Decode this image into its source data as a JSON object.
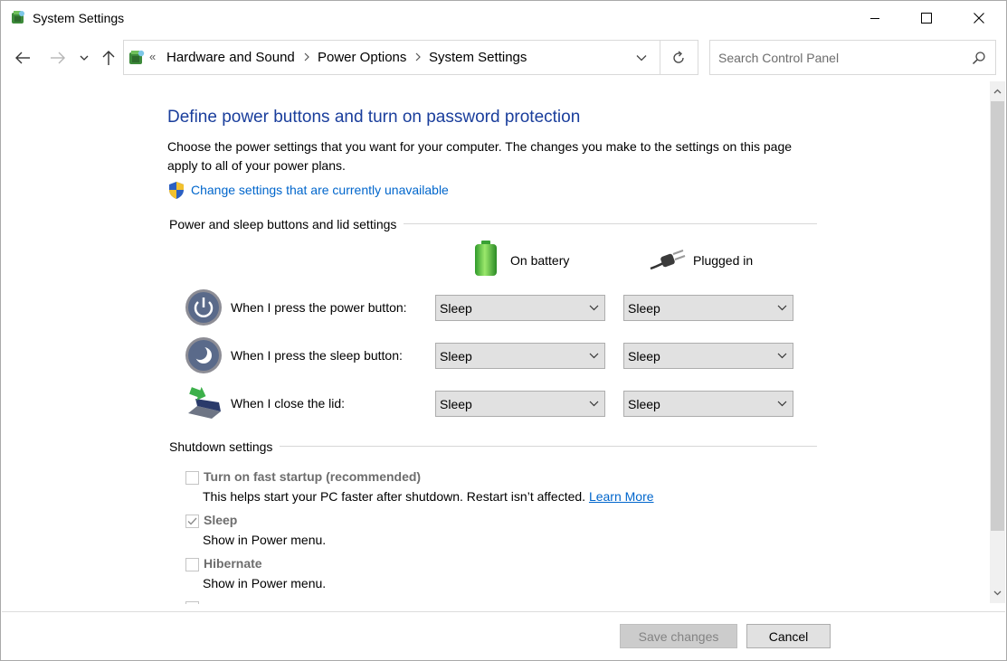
{
  "window": {
    "title": "System Settings"
  },
  "address": {
    "overflow": "«",
    "crumbs": [
      "Hardware and Sound",
      "Power Options",
      "System Settings"
    ]
  },
  "search": {
    "placeholder": "Search Control Panel"
  },
  "main": {
    "heading": "Define power buttons and turn on password protection",
    "description": "Choose the power settings that you want for your computer. The changes you make to the settings on this page apply to all of your power plans.",
    "change_link": "Change settings that are currently unavailable"
  },
  "power_section": {
    "title": "Power and sleep buttons and lid settings",
    "columns": {
      "battery": "On battery",
      "plugged": "Plugged in"
    },
    "rows": [
      {
        "label": "When I press the power button:",
        "battery": "Sleep",
        "plugged": "Sleep",
        "icon": "power-button-icon"
      },
      {
        "label": "When I press the sleep button:",
        "battery": "Sleep",
        "plugged": "Sleep",
        "icon": "sleep-button-icon"
      },
      {
        "label": "When I close the lid:",
        "battery": "Sleep",
        "plugged": "Sleep",
        "icon": "laptop-lid-icon"
      }
    ]
  },
  "shutdown_section": {
    "title": "Shutdown settings",
    "items": [
      {
        "label": "Turn on fast startup (recommended)",
        "desc": "This helps start your PC faster after shutdown. Restart isn’t affected. ",
        "link": "Learn More",
        "checked": false
      },
      {
        "label": "Sleep",
        "desc": "Show in Power menu.",
        "checked": true
      },
      {
        "label": "Hibernate",
        "desc": "Show in Power menu.",
        "checked": false
      }
    ]
  },
  "footer": {
    "save": "Save changes",
    "cancel": "Cancel"
  },
  "colors": {
    "heading": "#1a3e9c",
    "link": "#0066cc",
    "disabled_text": "#6d6d6d"
  }
}
